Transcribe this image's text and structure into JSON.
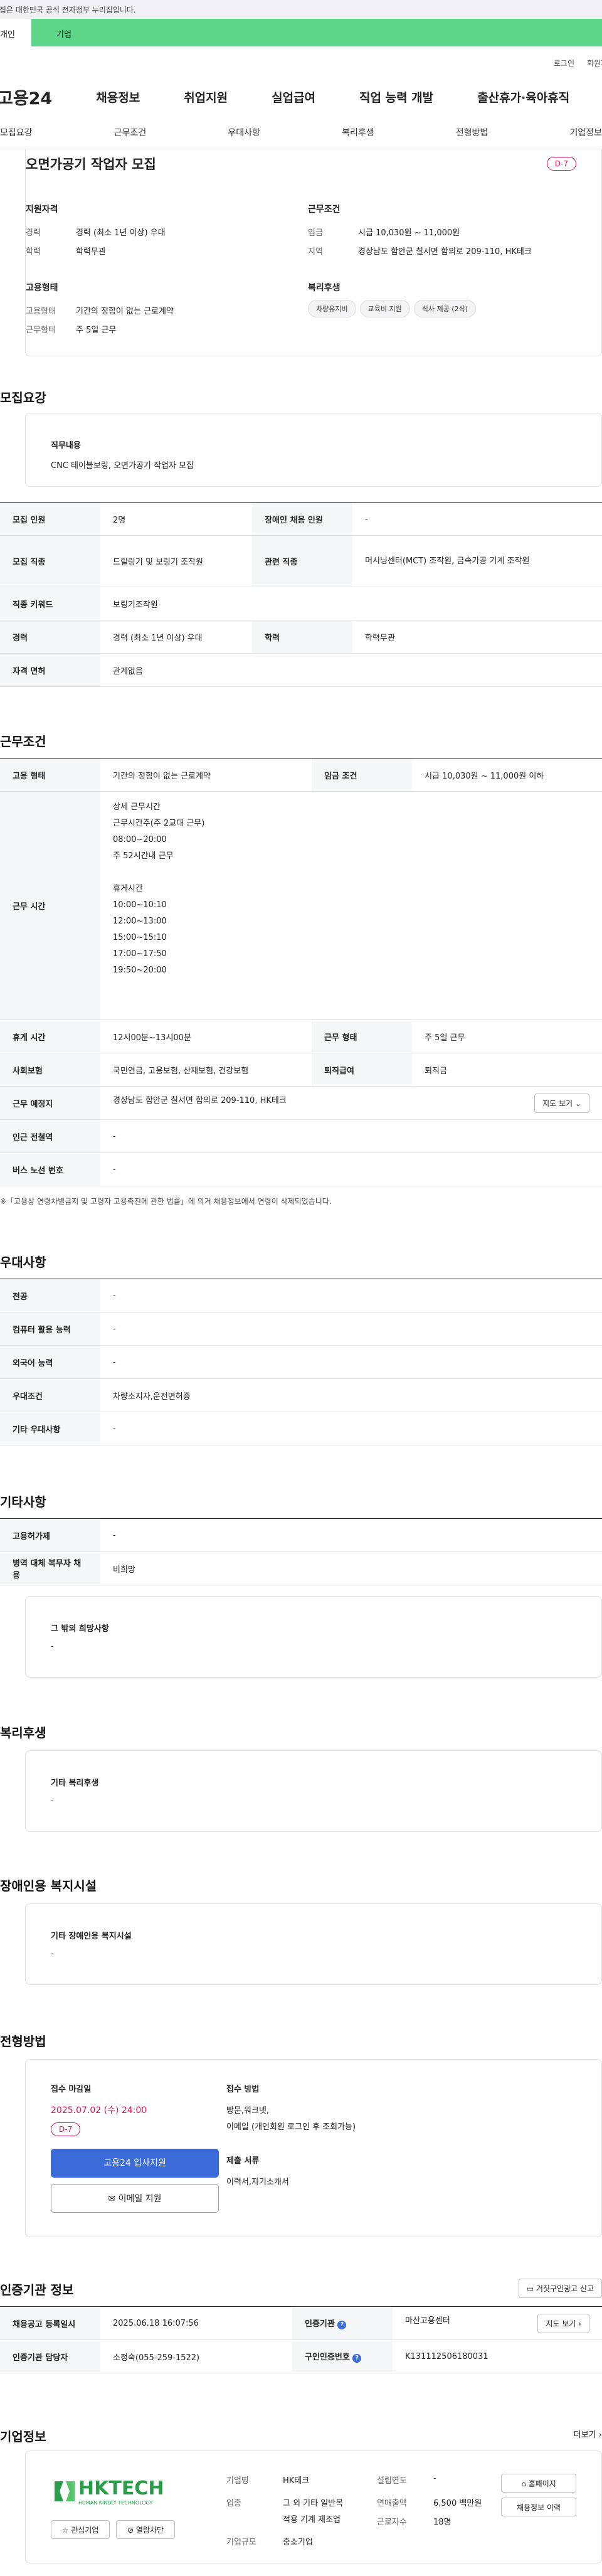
{
  "gov_banner": "이 누리집은 대한민국 공식 전자정부 누리집입니다.",
  "top_tabs": {
    "individual": "개인",
    "company": "기업"
  },
  "util": {
    "login": "로그인",
    "join": "회원가입"
  },
  "gnb": {
    "logo": "고용24",
    "menu": [
      "채용정보",
      "취업지원",
      "실업급여",
      "직업 능력 개발",
      "출산휴가·육아휴직"
    ]
  },
  "anchors": [
    "모집요강",
    "근무조건",
    "우대사항",
    "복리후생",
    "전형방법",
    "기업정보"
  ],
  "summary": {
    "title": "오면가공기 작업자 모집",
    "dday": "D-7",
    "qual_h": "지원자격",
    "career_l": "경력",
    "career_v": "경력 (최소 1년 이상) 우대",
    "edu_l": "학력",
    "edu_v": "학력무관",
    "cond_h": "근무조건",
    "wage_l": "임금",
    "wage_v": "시급 10,030원 ~ 11,000원",
    "area_l": "지역",
    "area_v": "경상남도 함안군 칠서면 함의로 209-110, HK테크",
    "emp_h": "고용형태",
    "type_l": "고용형태",
    "type_v": "기간의 정함이 없는 근로계약",
    "form_l": "근무형태",
    "form_v": "주 5일 근무",
    "welfare_h": "복리후생",
    "tags": [
      "차량유지비",
      "교육비 지원",
      "식사 제공 (2식)"
    ]
  },
  "recruit": {
    "heading": "모집요강",
    "job_h": "직무내용",
    "job_v": "CNC 테이블보링, 오면가공기 작업자 모집",
    "rows": {
      "count_l": "모집 인원",
      "count_v": "2명",
      "disabled_l": "장애인 채용 인원",
      "disabled_v": "-",
      "occ_l": "모집 직종",
      "occ_v": "드릴링기 및 보링기 조작원",
      "rel_l": "관련 직종",
      "rel_v": "머시닝센터(MCT) 조작원, 금속가공 기계 조작원",
      "kw_l": "직종 키워드",
      "kw_v": "보링기조작원",
      "car_l": "경력",
      "car_v": "경력 (최소 1년 이상) 우대",
      "edu_l": "학력",
      "edu_v": "학력무관",
      "lic_l": "자격 면허",
      "lic_v": "관계없음"
    }
  },
  "conditions": {
    "heading": "근무조건",
    "emp_l": "고용 형태",
    "emp_v": "기간의 정함이 없는 근로계약",
    "wage_l": "임금 조건",
    "wage_v": "시급 10,030원 ~ 11,000원 이하",
    "time_l": "근무 시간",
    "time_lines": [
      "상세 근무시간",
      "근무시간주(주 2교대 근무)",
      "08:00~20:00",
      "주 52시간내 근무",
      "",
      "휴게시간",
      "10:00~10:10",
      "12:00~13:00",
      "15:00~15:10",
      "17:00~17:50",
      "19:50~20:00"
    ],
    "rest_l": "휴게 시간",
    "rest_v": "12시00분~13시00분",
    "form_l": "근무 형태",
    "form_v": "주 5일 근무",
    "ins_l": "사회보험",
    "ins_v": "국민연금, 고용보험, 산재보험, 건강보험",
    "ret_l": "퇴직급여",
    "ret_v": "퇴직금",
    "loc_l": "근무 예정지",
    "loc_v": "경상남도 함안군 칠서면 함의로 209-110, HK테크",
    "map_btn": "지도 보기",
    "sub_l": "인근 전철역",
    "sub_v": "-",
    "bus_l": "버스 노선 번호",
    "bus_v": "-",
    "note": "※「고용상 연령차별금지 및 고령자 고용촉진에 관한 법률」에 의거 채용정보에서 연령이 삭제되었습니다."
  },
  "prefer": {
    "heading": "우대사항",
    "major_l": "전공",
    "major_v": "-",
    "pc_l": "컴퓨터 활용 능력",
    "pc_v": "-",
    "lang_l": "외국어 능력",
    "lang_v": "-",
    "cond_l": "우대조건",
    "cond_v": "차량소지자,운전면허증",
    "etc_l": "기타 우대사항",
    "etc_v": "-"
  },
  "other": {
    "heading": "기타사항",
    "apply_l": "고용허가제",
    "apply_v": "-",
    "mil_l": "병역 대체 복무자 채용",
    "mil_v": "비희망",
    "wish_h": "그 밖의 희망사항",
    "wish_v": "-"
  },
  "welfare": {
    "heading": "복리후생",
    "etc_h": "기타 복리후생",
    "etc_v": "-"
  },
  "disabled": {
    "heading": "장애인용 복지시설",
    "etc_h": "기타 장애인용 복지시설",
    "etc_v": "-"
  },
  "selection": {
    "heading": "전형방법",
    "deadline_h": "접수 마감일",
    "deadline_v": "2025.07.02 (수) 24:00",
    "dday": "D-7",
    "apply_btn": "고용24 입사지원",
    "email_btn": "이메일 지원",
    "method_h": "접수 방법",
    "method_v1": "방문,워크넷,",
    "method_v2": "이메일 (개인회원 로그인 후 조회가능)",
    "docs_h": "제출 서류",
    "docs_v": "이력서,자기소개서"
  },
  "cert": {
    "heading": "인증기관 정보",
    "report_btn": "거짓구인광고 신고",
    "reg_l": "채용공고 등록일시",
    "reg_v": "2025.06.18 16:07:56",
    "org_l": "인증기관",
    "org_v": "마산고용센터",
    "map_btn": "지도 보기",
    "mgr_l": "인증기관 담당자",
    "mgr_v": "소정숙(055-259-1522)",
    "num_l": "구인인증번호",
    "num_v": "K131112506180031"
  },
  "company": {
    "heading": "기업정보",
    "more": "더보기",
    "logo_text": "HKTECH",
    "logo_sub": "HUMAN KINDLY TECHNOLOGY",
    "fav_btn": "관심기업",
    "block_btn": "열람차단",
    "name_l": "기업명",
    "name_v": "HK테크",
    "ind_l": "업종",
    "ind_v1": "그 외 기타 일반목",
    "ind_v2": "적용 기계 제조업",
    "size_l": "기업규모",
    "size_v": "중소기업",
    "est_l": "설립연도",
    "est_v": "-",
    "sales_l": "연매출액",
    "sales_v": "6,500 백만원",
    "emp_l": "근로자수",
    "emp_v": "18명",
    "home_btn": "홈페이지",
    "jobs_btn": "채용정보 이력"
  },
  "colors": {
    "accent": "#3a6bd8",
    "dday": "#d3195a",
    "corp_tab": "#5dd68a"
  }
}
